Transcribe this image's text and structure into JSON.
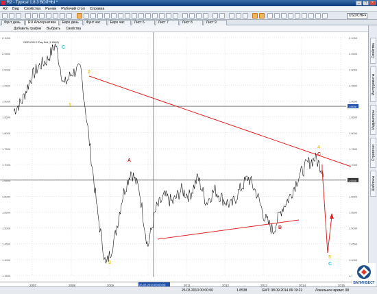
{
  "window": {
    "title": "R2 - Typical 1.8.3 ВОЛНЫ *"
  },
  "menu": [
    "R2",
    "Вид",
    "Свойства",
    "Рынки",
    "Рабочий стол",
    "Справка"
  ],
  "toolbar": {
    "pair": "USD/CHF"
  },
  "tabs": [
    {
      "label": "Фунт день",
      "active": false
    },
    {
      "label": "RU Альтернатива",
      "active": true
    },
    {
      "label": "Евро день",
      "active": false
    },
    {
      "label": "Фунт час",
      "active": false
    },
    {
      "label": "Евро час",
      "active": false
    },
    {
      "label": "Лист 6",
      "active": false
    },
    {
      "label": "Лист 7",
      "active": false
    },
    {
      "label": "Лист 8",
      "active": false
    },
    {
      "label": "Лист 9",
      "active": false
    }
  ],
  "chart_toolbar": {
    "add_chart": "Добавить график",
    "select": "Выбрать",
    "properties": "Свойства"
  },
  "sidebar": [
    "Свойства",
    "Инструменты",
    "Индикаторы",
    "Стратегии",
    "Шаблоны"
  ],
  "chart": {
    "instrument_label": "GBPUSD.E Day Bid (1.6508)",
    "price_marker_1": "1.8838",
    "price_marker_2": "1.6508",
    "crosshair_date": "26.03.2010 00:00:00"
  },
  "chart_data": {
    "type": "line",
    "title": "",
    "xlabel": "",
    "ylabel": "",
    "x_tick_labels": [
      "2007",
      "2008",
      "2009",
      "2010",
      "2011",
      "2012",
      "2013",
      "2014",
      "2015"
    ],
    "y_tick_labels": [
      "2.1000",
      "2.0500",
      "2.0000",
      "1.9500",
      "1.9000",
      "1.8500",
      "1.8000",
      "1.7500",
      "1.7000",
      "1.6500",
      "1.6000",
      "1.5500",
      "1.5000",
      "1.4500",
      "1.4000",
      "1.3500"
    ],
    "series": [
      {
        "values": [
          1.87,
          1.9,
          1.97,
          2.01,
          2.03,
          2.08,
          1.95,
          1.99,
          2.0,
          1.78,
          1.55,
          1.38,
          1.46,
          1.6,
          1.68,
          1.62,
          1.44,
          1.56,
          1.6,
          1.58,
          1.62,
          1.6,
          1.66,
          1.58,
          1.62,
          1.59,
          1.57,
          1.62,
          1.66,
          1.61,
          1.53,
          1.49,
          1.56,
          1.6,
          1.66,
          1.7,
          1.72,
          1.68
        ]
      }
    ],
    "wave_labels": [
      {
        "text": "1",
        "color": "#e6c800"
      },
      {
        "text": "2",
        "color": "#e6c800"
      },
      {
        "text": "3",
        "color": "#e6c800"
      },
      {
        "text": "4",
        "color": "#e6c800"
      },
      {
        "text": "5",
        "color": "#e6c800"
      },
      {
        "text": "A",
        "color": "#d02020"
      },
      {
        "text": "B",
        "color": "#d02020"
      },
      {
        "text": "C",
        "color": "#d02020"
      },
      {
        "text": "C",
        "color": "#20c8e8"
      },
      {
        "text": "C",
        "color": "#20c8e8"
      }
    ]
  },
  "status": {
    "datetime_crosshair": "26.03.2010 00:00:00",
    "price_cursor": "1.8538",
    "server_time": "GMT: 08.09.2014 06:19:22",
    "local_time_label": "Локальное время: 08"
  },
  "logo": {
    "text": "ВАЛИНВЕСТ"
  }
}
